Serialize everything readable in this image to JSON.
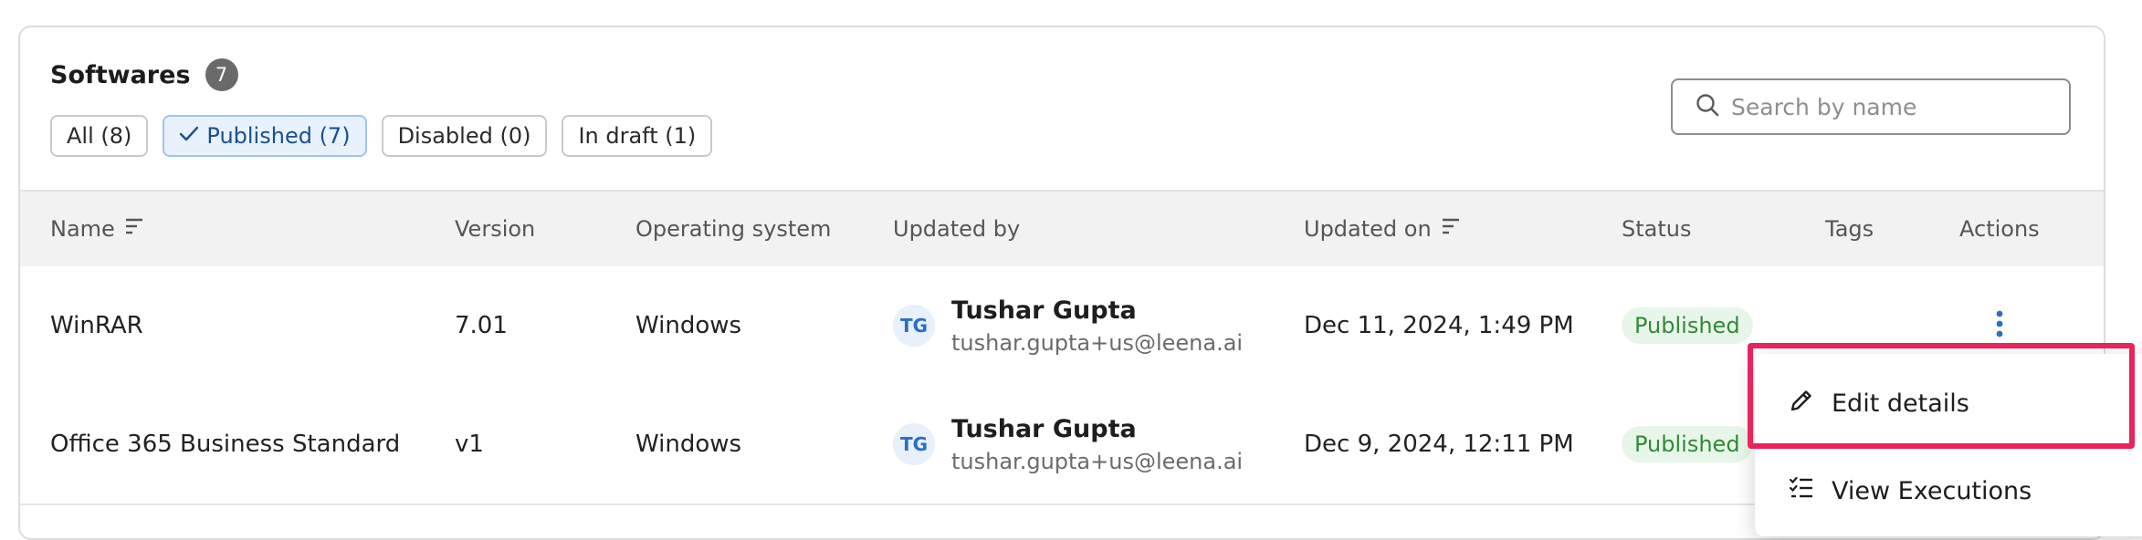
{
  "header": {
    "title": "Softwares",
    "count": "7"
  },
  "filters": [
    {
      "label": "All (8)",
      "active": false
    },
    {
      "label": "Published (7)",
      "active": true
    },
    {
      "label": "Disabled (0)",
      "active": false
    },
    {
      "label": "In draft (1)",
      "active": false
    }
  ],
  "search": {
    "placeholder": "Search by name",
    "value": ""
  },
  "table": {
    "columns": {
      "name": "Name",
      "version": "Version",
      "os": "Operating system",
      "updated_by": "Updated by",
      "updated_on": "Updated on",
      "status": "Status",
      "tags": "Tags",
      "actions": "Actions"
    },
    "rows": [
      {
        "name": "WinRAR",
        "version": "7.01",
        "os": "Windows",
        "initials": "TG",
        "user_name": "Tushar Gupta",
        "user_email": "tushar.gupta+us@leena.ai",
        "updated_on": "Dec 11, 2024, 1:49 PM",
        "status": "Published"
      },
      {
        "name": "Office 365 Business Standard",
        "version": "v1",
        "os": "Windows",
        "initials": "TG",
        "user_name": "Tushar Gupta",
        "user_email": "tushar.gupta+us@leena.ai",
        "updated_on": "Dec 9, 2024, 12:11 PM",
        "status": "Published"
      }
    ]
  },
  "actions_menu": {
    "items": [
      {
        "label": "Edit details",
        "icon": "pencil-icon"
      },
      {
        "label": "View Executions",
        "icon": "checklist-icon"
      }
    ]
  },
  "colors": {
    "highlight": "#e8245a",
    "accent": "#2a6fc2",
    "published": "#2f8a36"
  }
}
